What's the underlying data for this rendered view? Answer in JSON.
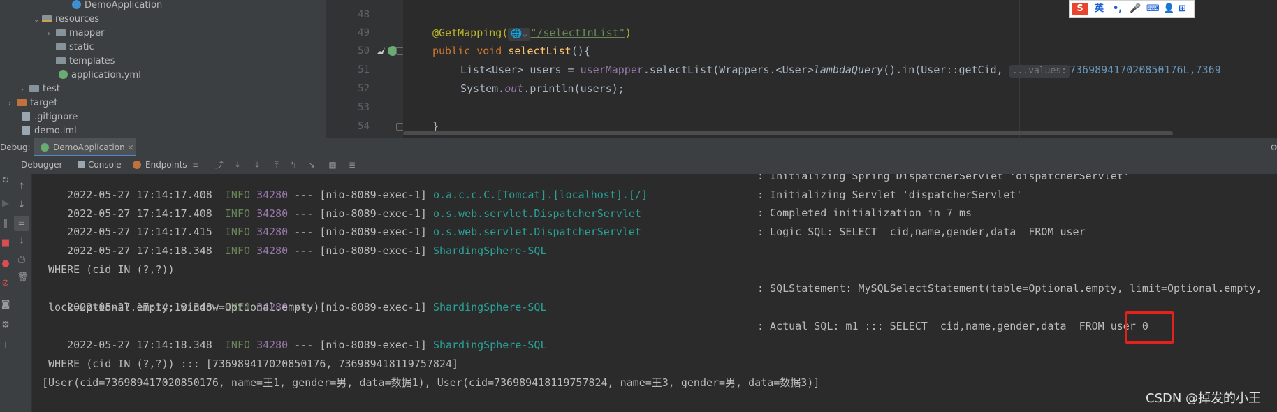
{
  "project_tree": {
    "items": [
      {
        "label": "DemoApplication"
      },
      {
        "label": "resources"
      },
      {
        "label": "mapper"
      },
      {
        "label": "static"
      },
      {
        "label": "templates"
      },
      {
        "label": "application.yml"
      },
      {
        "label": "test"
      },
      {
        "label": "target"
      },
      {
        "label": ".gitignore"
      },
      {
        "label": "demo.iml"
      }
    ]
  },
  "editor": {
    "line_numbers": [
      "48",
      "49",
      "50",
      "51",
      "52",
      "53",
      "54"
    ],
    "line49": {
      "annotation": "@GetMapping(",
      "hint": "🌐⌄",
      "path": "\"/selectInList\"",
      "close": ")"
    },
    "line50": {
      "kw1": "public",
      "kw2": "void",
      "method": "selectList",
      "rest": "(){"
    },
    "line51": {
      "p1": "List<User> users = ",
      "field": "userMapper",
      "p2": ".selectList(Wrappers.<User>",
      "call": "lambdaQuery",
      "p3": "().in(User::getCid, ",
      "hint": "...values:",
      "nums": "736989417020850176L,7369"
    },
    "line52": {
      "p1": "System.",
      "field": "out",
      "p2": ".println(users);"
    },
    "line54": {
      "text": "}"
    }
  },
  "ime": {
    "s": "S",
    "lang": "英",
    "items": [
      "•,",
      "🎤",
      "⌨",
      "👤",
      "⊞"
    ]
  },
  "debug": {
    "label": "Debug:",
    "tab": "DemoApplication"
  },
  "toolbar": {
    "debugger": "Debugger",
    "console": "Console",
    "endpoints": "Endpoints"
  },
  "console_lines": [
    {
      "ts": "2022-05-27 17:14:17.408",
      "level": "INFO",
      "pid": "34280",
      "sep": "---",
      "thread": "[nio-8089-exec-1]",
      "logger": "o.a.c.c.C.[Tomcat].[localhost].[/]",
      "msg": ": Initializing Spring DispatcherServlet 'dispatcherServlet'"
    },
    {
      "ts": "2022-05-27 17:14:17.408",
      "level": "INFO",
      "pid": "34280",
      "sep": "---",
      "thread": "[nio-8089-exec-1]",
      "logger": "o.s.web.servlet.DispatcherServlet",
      "msg": ": Initializing Servlet 'dispatcherServlet'"
    },
    {
      "ts": "2022-05-27 17:14:17.415",
      "level": "INFO",
      "pid": "34280",
      "sep": "---",
      "thread": "[nio-8089-exec-1]",
      "logger": "o.s.web.servlet.DispatcherServlet",
      "msg": ": Completed initialization in 7 ms"
    },
    {
      "ts": "2022-05-27 17:14:18.348",
      "level": "INFO",
      "pid": "34280",
      "sep": "---",
      "thread": "[nio-8089-exec-1]",
      "logger": "ShardingSphere-SQL",
      "msg": ": Logic SQL: SELECT  cid,name,gender,data  FROM user"
    },
    {
      "plain": " WHERE (cid IN (?,?))"
    },
    {
      "ts": "2022-05-27 17:14:18.348",
      "level": "INFO",
      "pid": "34280",
      "sep": "---",
      "thread": "[nio-8089-exec-1]",
      "logger": "ShardingSphere-SQL",
      "msg": ": SQLStatement: MySQLSelectStatement(table=Optional.empty, limit=Optional.empty,"
    },
    {
      "plain": " lock=Optional.empty, window=Optional.empty)"
    },
    {
      "ts": "2022-05-27 17:14:18.348",
      "level": "INFO",
      "pid": "34280",
      "sep": "---",
      "thread": "[nio-8089-exec-1]",
      "logger": "ShardingSphere-SQL",
      "msg": ": Actual SQL: m1 ::: SELECT  cid,name,gender,data  FROM user_0"
    },
    {
      "plain": " WHERE (cid IN (?,?)) ::: [736989417020850176, 736989418119757824]"
    },
    {
      "plain": "[User(cid=736989417020850176, name=王1, gender=男, data=数据1), User(cid=736989418119757824, name=王3, gender=男, data=数据3)]"
    }
  ],
  "watermark": "CSDN @掉发的小王",
  "colors": {
    "highlight_box": "#e5211b",
    "logger": "#2aa198",
    "level": "#6a8759",
    "pid": "#9876aa"
  }
}
